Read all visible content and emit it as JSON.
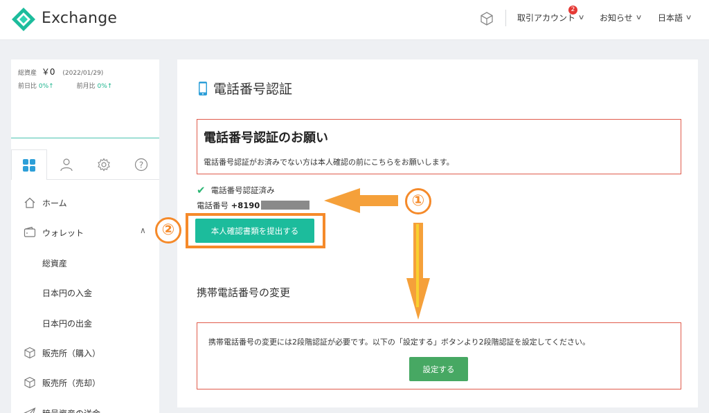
{
  "header": {
    "brand": "Exchange",
    "account_label": "取引アカウント",
    "account_badge": "2",
    "news_label": "お知らせ",
    "language_label": "日本語",
    "accent_color": "#1cbc9c"
  },
  "sidebar": {
    "assets": {
      "label": "総資産",
      "value": "￥0",
      "date": "(2022/01/29)",
      "day_label": "前日比",
      "day_value": "0%↑",
      "month_label": "前月比",
      "month_value": "0%↑"
    },
    "tabs": [
      "grid-icon",
      "user-icon",
      "gear-icon",
      "help-icon"
    ],
    "items": [
      {
        "label": "ホーム",
        "icon": "home-icon"
      },
      {
        "label": "ウォレット",
        "icon": "wallet-icon"
      },
      {
        "label": "総資産",
        "icon": ""
      },
      {
        "label": "日本円の入金",
        "icon": ""
      },
      {
        "label": "日本円の出金",
        "icon": ""
      },
      {
        "label": "販売所（購入）",
        "icon": "cube-icon"
      },
      {
        "label": "販売所（売却）",
        "icon": "cube-icon"
      },
      {
        "label": "暗号資産の送金",
        "icon": "send-icon"
      }
    ]
  },
  "main": {
    "title": "電話番号認証",
    "notice_heading": "電話番号認証のお願い",
    "notice_text": "電話番号認証がお済みでない方は本人確認の前にこちらをお願いします。",
    "verified_text": "電話番号認証済み",
    "phone_label": "電話番号",
    "phone_value": "+8190",
    "submit_button": "本人確認書類を提出する",
    "change_heading": "携帯電話番号の変更",
    "change_text": "携帯電話番号の変更には2段階認証が必要です。以下の「設定する」ボタンより2段階認証を設定してください。",
    "settings_button": "設定する"
  },
  "annotations": {
    "marker1": "①",
    "marker2": "②",
    "color": "#f58a2a"
  }
}
